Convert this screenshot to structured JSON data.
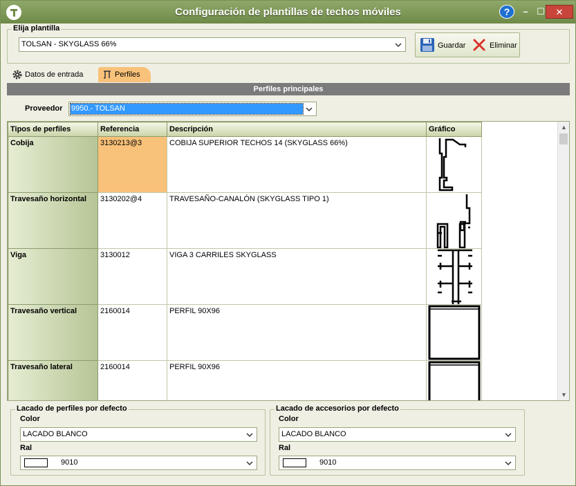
{
  "window": {
    "title": "Configuración de plantillas de techos móviles",
    "help_label": "?",
    "minimize_label": "–",
    "maximize_label": "☐",
    "close_label": "✕"
  },
  "template_group": {
    "title": "Elija plantilla",
    "selected": "TOLSAN - SKYGLASS 66%"
  },
  "toolbar": {
    "save_label": "Guardar",
    "delete_label": "Eliminar"
  },
  "tabs": [
    {
      "label": "Datos de entrada",
      "active": false
    },
    {
      "label": "Perfiles",
      "active": true
    }
  ],
  "section_header": "Perfiles principales",
  "provider": {
    "label": "Proveedor",
    "selected": "9950.- TOLSAN"
  },
  "profiles_table": {
    "columns": [
      "Tipos de perfiles",
      "Referencia",
      "Descripción",
      "Gráfico"
    ],
    "rows": [
      {
        "type": "Cobija",
        "reference": "3130213@3",
        "description": "COBIJA SUPERIOR TECHOS 14 (SKYGLASS 66%)",
        "graphic": "cobija-profile-drawing"
      },
      {
        "type": "Travesaño horizontal",
        "reference": "3130202@4",
        "description": "TRAVESAÑO-CANALÓN (SKYGLASS TIPO 1)",
        "graphic": "gutter-profile-drawing"
      },
      {
        "type": "Viga",
        "reference": "3130012",
        "description": "VIGA 3 CARRILES SKYGLASS",
        "graphic": "beam-profile-drawing"
      },
      {
        "type": "Travesaño vertical",
        "reference": "2160014",
        "description": "PERFIL 90X96",
        "graphic": "square-profile-drawing"
      },
      {
        "type": "Travesaño lateral",
        "reference": "2160014",
        "description": "PERFIL 90X96",
        "graphic": "square-profile-drawing"
      }
    ]
  },
  "profile_lacquer": {
    "title": "Lacado de perfiles por defecto",
    "color_label": "Color",
    "color_value": "LACADO BLANCO",
    "ral_label": "Ral",
    "ral_value": "9010"
  },
  "accessory_lacquer": {
    "title": "Lacado de accesorios por defecto",
    "color_label": "Color",
    "color_value": "LACADO BLANCO",
    "ral_label": "Ral",
    "ral_value": "9010"
  },
  "colors": {
    "titlebar": "#7f9a57",
    "active_tab": "#f9c27a",
    "selected_cell": "#f9c27a",
    "provider_highlight": "#3399ff",
    "section_header": "#7b7b7b"
  }
}
